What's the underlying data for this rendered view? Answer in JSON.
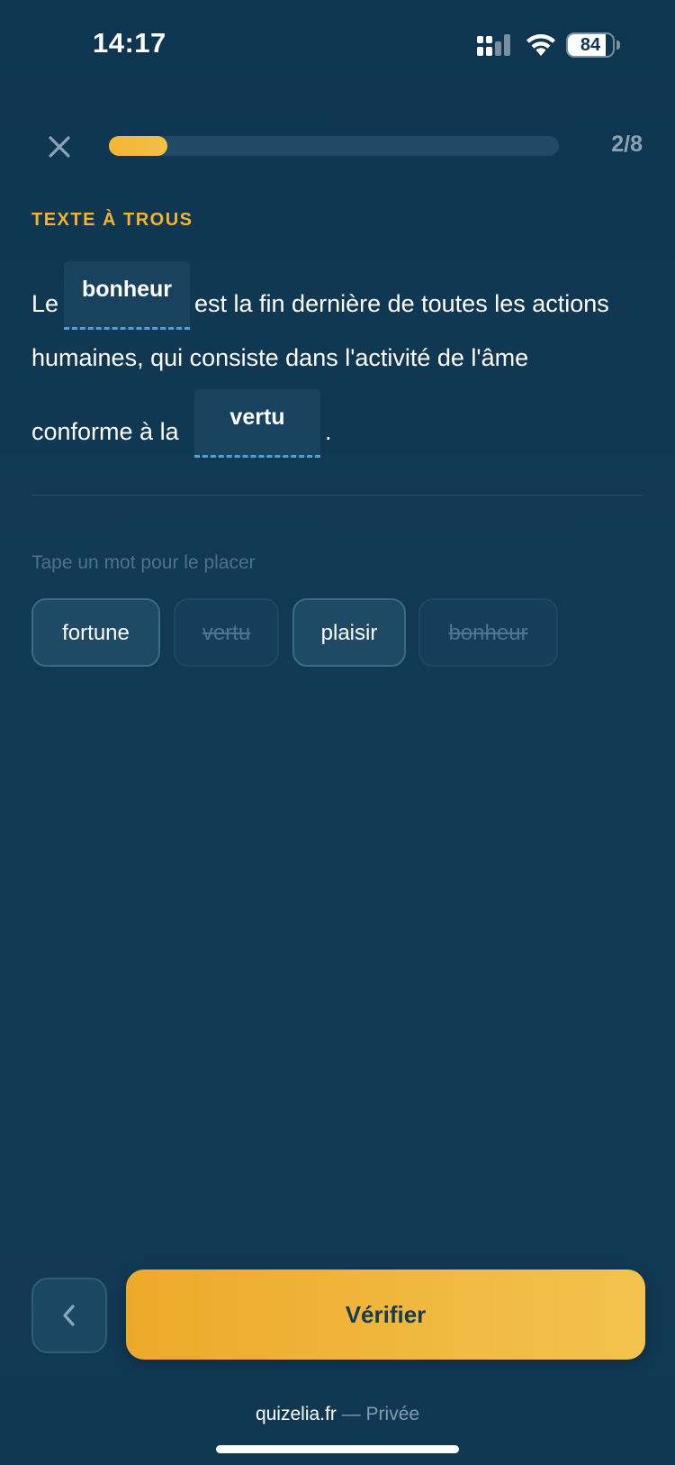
{
  "status_bar": {
    "time": "14:17",
    "battery": "84",
    "battery_level": 0.84
  },
  "header": {
    "progress_count": "2/8",
    "progress_fraction": 0.13
  },
  "exercise": {
    "section_label": "TEXTE À TROUS",
    "sentence": {
      "part1": "Le",
      "blank1": "bonheur",
      "part2": "est la fin dernière de toutes les actions",
      "part3": "humaines, qui consiste dans l'activité de l'âme",
      "part4": "conforme à la",
      "blank2": "vertu",
      "part5": "."
    },
    "hint": "Tape un mot pour le placer",
    "chips": [
      {
        "label": "fortune",
        "used": false
      },
      {
        "label": "vertu",
        "used": true
      },
      {
        "label": "plaisir",
        "used": false
      },
      {
        "label": "bonheur",
        "used": true
      }
    ]
  },
  "footer": {
    "verify_label": "Vérifier",
    "site": "quizelia.fr",
    "separator": "— Privée"
  },
  "icons": [
    "close-icon",
    "chevron-left-icon",
    "signal-icon",
    "wifi-icon",
    "battery-icon"
  ],
  "colors": {
    "accent": "#f1b52e",
    "background": "#123a55",
    "blank_underline": "#4aa3d4"
  }
}
